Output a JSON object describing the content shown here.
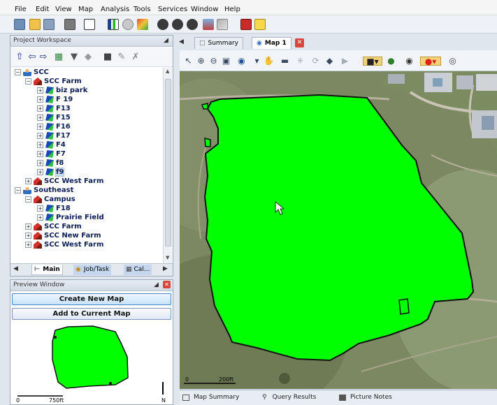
{
  "menu": [
    "File",
    "Edit",
    "View",
    "Map",
    "Analysis",
    "Tools",
    "Services",
    "Window",
    "Help"
  ],
  "workspace": {
    "title": "Project Workspace",
    "tree": [
      {
        "label": "SCC",
        "type": "grower",
        "expander": "−"
      },
      {
        "label": "SCC Farm",
        "type": "farm",
        "expander": "−"
      },
      {
        "label": "biz park",
        "type": "field",
        "expander": "+"
      },
      {
        "label": "F 19",
        "type": "field",
        "expander": "+"
      },
      {
        "label": "F13",
        "type": "field",
        "expander": "+"
      },
      {
        "label": "F15",
        "type": "field",
        "expander": "+"
      },
      {
        "label": "F16",
        "type": "field",
        "expander": "+"
      },
      {
        "label": "F17",
        "type": "field",
        "expander": "+"
      },
      {
        "label": "F4",
        "type": "field",
        "expander": "+"
      },
      {
        "label": "F7",
        "type": "field",
        "expander": "+"
      },
      {
        "label": "f8",
        "type": "field",
        "expander": "+"
      },
      {
        "label": "f9",
        "type": "field",
        "expander": "+",
        "selected": true
      },
      {
        "label": "SCC West Farm",
        "type": "farm",
        "expander": "+"
      },
      {
        "label": "Southeast",
        "type": "grower",
        "expander": "−"
      },
      {
        "label": "Campus",
        "type": "farm",
        "expander": "−"
      },
      {
        "label": "F18",
        "type": "field",
        "expander": "+"
      },
      {
        "label": "Prairie Field",
        "type": "field",
        "expander": "+"
      },
      {
        "label": "SCC Farm",
        "type": "farm",
        "expander": "+"
      },
      {
        "label": "SCC New Farm",
        "type": "farm",
        "expander": "+"
      },
      {
        "label": "SCC West Farm",
        "type": "farm",
        "expander": "+"
      }
    ],
    "tabs": [
      "Main",
      "Job/Task",
      "Cal..."
    ]
  },
  "preview": {
    "title": "Preview Window",
    "create_label": "Create New Map",
    "add_label": "Add to Current Map",
    "scale_zero": "0",
    "scale_label": "750ft",
    "north": "N"
  },
  "map_tabs": [
    "Summary",
    "Map 1"
  ],
  "map": {
    "scale_zero": "0",
    "scale_label": "200ft",
    "field_color": "#00ff00"
  },
  "bottom_tabs": [
    "Map Summary",
    "Query Results",
    "Picture Notes"
  ]
}
